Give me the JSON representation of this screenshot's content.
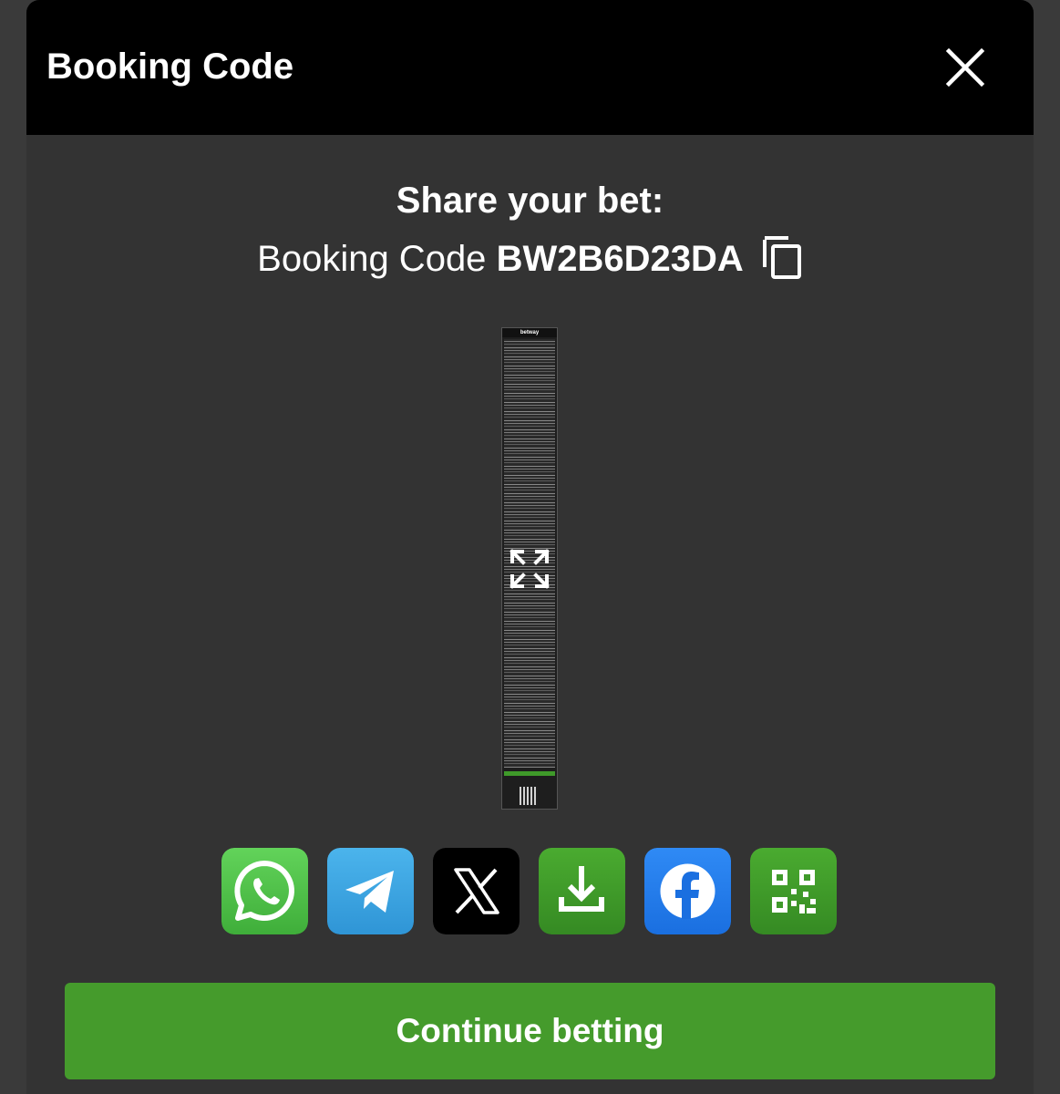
{
  "modal": {
    "title": "Booking Code"
  },
  "share": {
    "heading": "Share your bet:",
    "code_label": "Booking Code",
    "code_value": "BW2B6D23DA"
  },
  "slip_preview": {
    "brand": "betway"
  },
  "share_buttons": [
    {
      "name": "whatsapp",
      "icon": "whatsapp-icon",
      "color": "#4fc24a"
    },
    {
      "name": "telegram",
      "icon": "telegram-icon",
      "color": "#3aa6e3"
    },
    {
      "name": "x",
      "icon": "x-icon",
      "color": "#000000"
    },
    {
      "name": "download",
      "icon": "download-icon",
      "color": "#3f9a2a"
    },
    {
      "name": "facebook",
      "icon": "facebook-icon",
      "color": "#1877f2"
    },
    {
      "name": "qr-code",
      "icon": "qr-code-icon",
      "color": "#3f9a2a"
    }
  ],
  "actions": {
    "continue_label": "Continue betting"
  },
  "colors": {
    "accent": "#459b2c",
    "header": "#000000",
    "panel": "#333333"
  }
}
